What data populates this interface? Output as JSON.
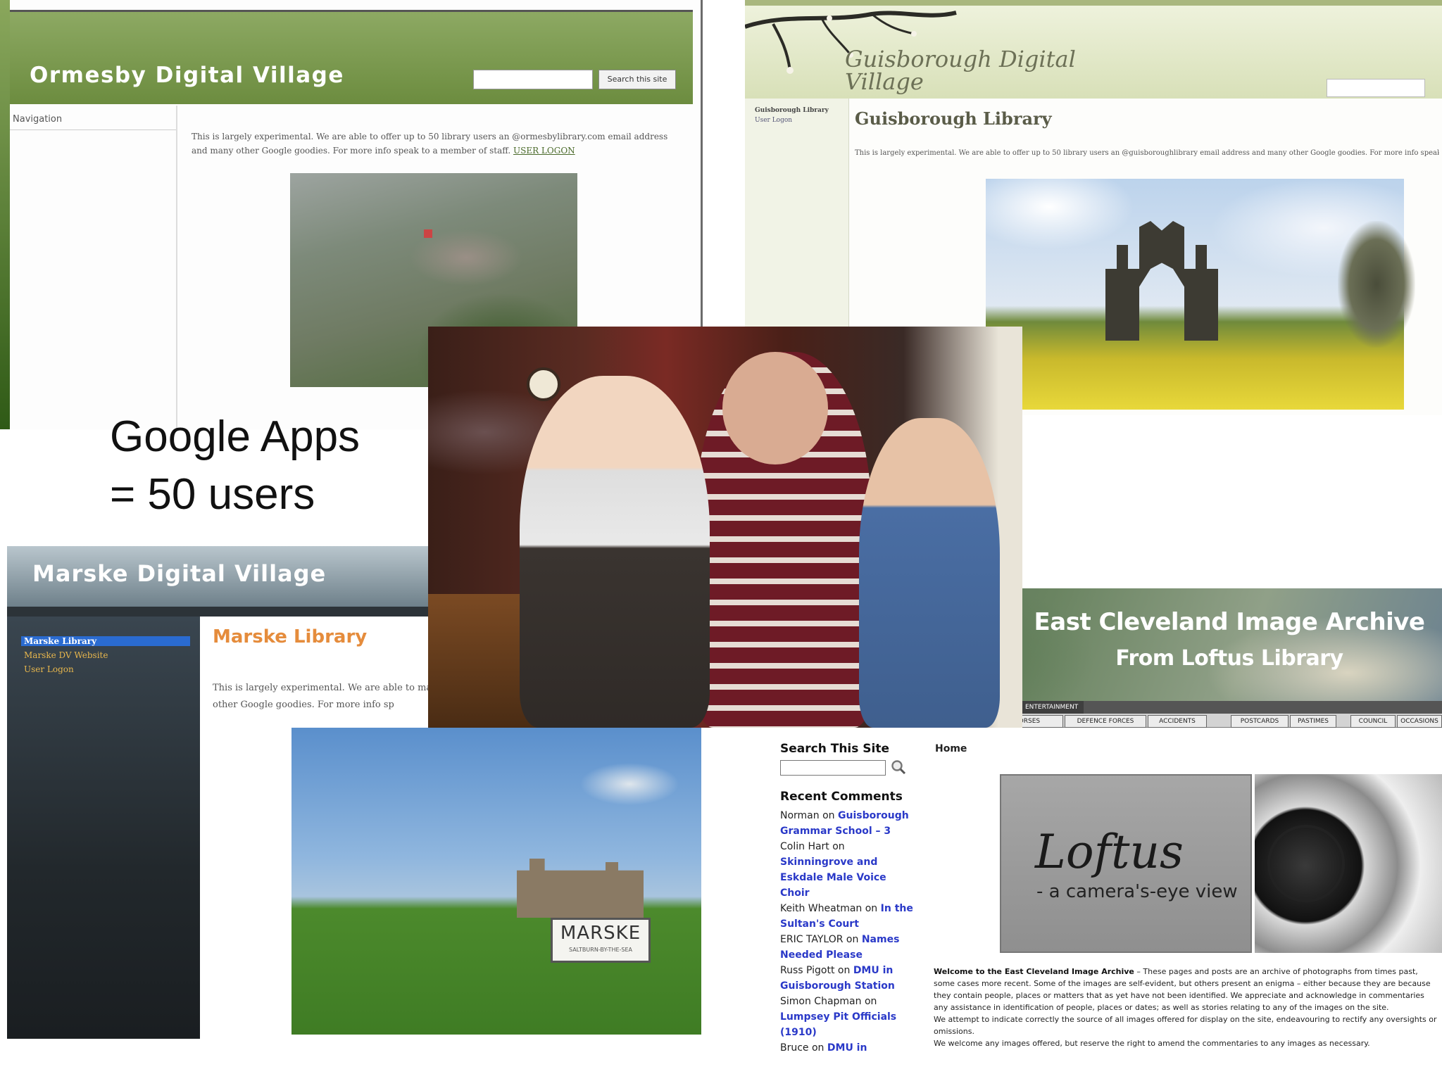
{
  "slide": {
    "caption_line1": "Google Apps",
    "caption_line2": "= 50 users"
  },
  "ormesby": {
    "title": "Ormesby Digital Village",
    "search_button": "Search this site",
    "nav_label": "Navigation",
    "body_text": "This is largely experimental. We are able to offer up to 50 library users an @ormesbylibrary.com email address and many other Google goodies. For more info speak to a member of staff.",
    "logon_link": "USER LOGON"
  },
  "guisborough": {
    "title": "Guisborough Digital Village",
    "sidebar_title": "Guisborough Library",
    "sidebar_link": "User Logon",
    "page_title": "Guisborough Library",
    "body_text": "This is largely experimental. We are able to offer up to 50 library users an @guisboroughlibrary email address and many other Google goodies. For more info speak to"
  },
  "marske": {
    "title": "Marske Digital Village",
    "sidebar_items": [
      "Marske Library",
      "Marske DV Website",
      "User Logon"
    ],
    "page_title": "Marske Library",
    "body_text": "This is largely experimental. We are able to many other Google goodies. For more info sp",
    "sign_text": "MARSKE",
    "sign_subtext": "SALTBURN-BY-THE-SEA"
  },
  "east_cleveland": {
    "banner_title": "East Cleveland Image Archive",
    "banner_subtitle": "From Loftus Library",
    "top_tab": "ENTERTAINMENT",
    "tabs": [
      "...NG & HORSES",
      "DEFENCE FORCES",
      "ACCIDENTS",
      "POSTCARDS",
      "PASTIMES",
      "COUNCIL",
      "OCCASIONS"
    ],
    "search_title": "Search This Site",
    "recent_comments_title": "Recent Comments",
    "comments": [
      {
        "who": "Norman on",
        "post": "Guisborough Grammar School – 3"
      },
      {
        "who": "Colin Hart on",
        "post": "Skinningrove and Eskdale Male Voice Choir"
      },
      {
        "who": "Keith Wheatman on",
        "post": "In the Sultan's Court"
      },
      {
        "who": "ERIC TAYLOR on",
        "post": "Names Needed Please"
      },
      {
        "who": "Russ Pigott on",
        "post": "DMU in Guisborough Station"
      },
      {
        "who": "Simon Chapman on",
        "post": "Lumpsey Pit Officials (1910)"
      },
      {
        "who": "Bruce on",
        "post": "DMU in"
      }
    ],
    "home_label": "Home",
    "loftus_title": "Loftus",
    "loftus_subtitle": "- a camera's-eye view",
    "welcome_heading": "Welcome to the East Cleveland Image Archive",
    "welcome_text": " – These pages and posts are an archive of photographs from times past, some cases more recent. Some of the images are self-evident, but others present an enigma – either because they are because they contain people, places or matters that as yet have not been identified. We appreciate and acknowledge in commentaries any assistance in identification of people, places or dates; as well as stories relating to any of the images on the site.",
    "welcome_text2": "We attempt to indicate correctly the source of all images offered for display on the site, endeavouring to rectify any oversights or omissions.",
    "welcome_text3": "We welcome any images offered, but reserve the right to amend the commentaries to any images as necessary."
  }
}
